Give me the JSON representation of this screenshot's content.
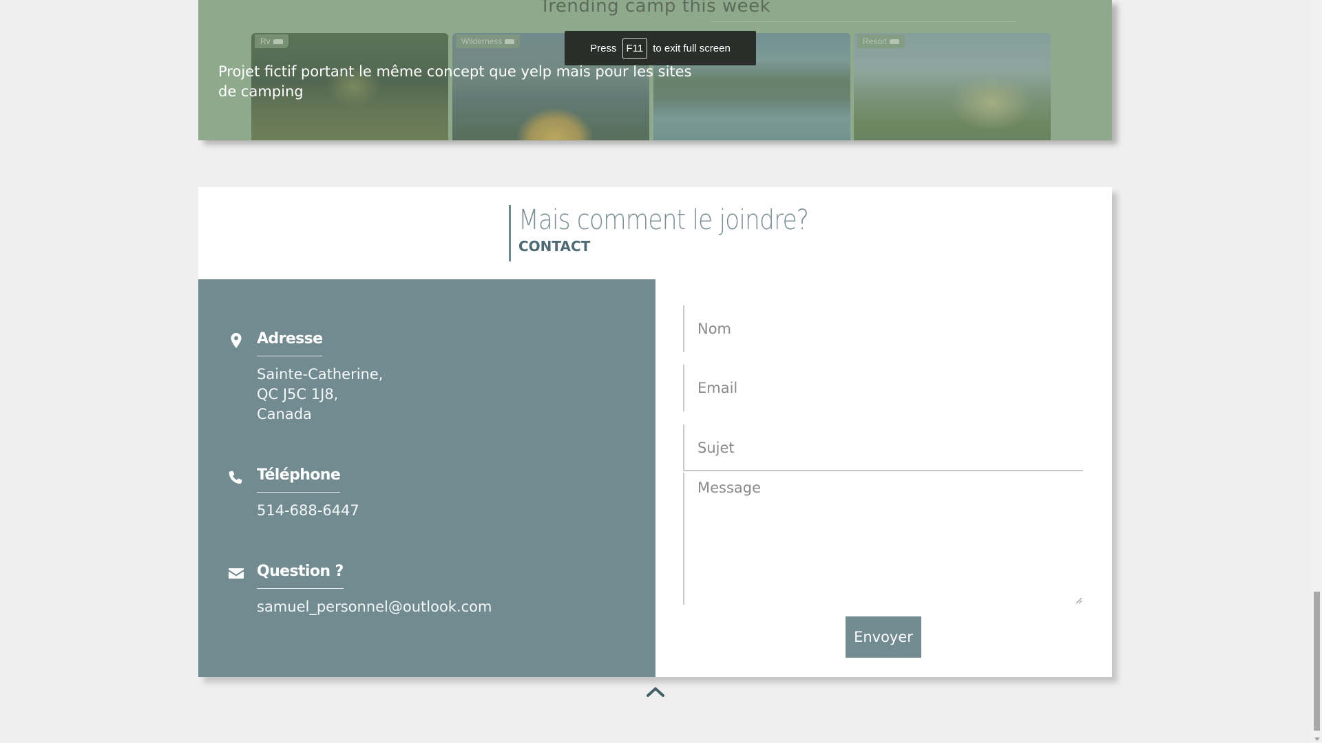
{
  "hero": {
    "title": "Trending camp this week",
    "description": "Projet fictif portant le même concept que yelp mais pour les sites de camping",
    "thumbnails": [
      {
        "tag": "Rv"
      },
      {
        "tag": "Wilderness"
      },
      {
        "tag": ""
      },
      {
        "tag": "Resort"
      }
    ]
  },
  "fullscreen_toast": {
    "prefix": "Press",
    "key": "F11",
    "suffix": "to exit full screen"
  },
  "contact": {
    "heading": "Mais comment le joindre?",
    "subheading": "CONTACT",
    "address": {
      "label": "Adresse",
      "lines": [
        "Sainte-Catherine,",
        "QC J5C 1J8,",
        "Canada"
      ]
    },
    "phone": {
      "label": "Téléphone",
      "value": "514-688-6447"
    },
    "question": {
      "label": "Question ?",
      "value": "samuel_personnel@outlook.com"
    },
    "form": {
      "name_placeholder": "Nom",
      "email_placeholder": "Email",
      "subject_placeholder": "Sujet",
      "message_placeholder": "Message",
      "submit_label": "Envoyer"
    }
  },
  "colors": {
    "hero_bg": "#8fa98c",
    "panel_bg": "#728b91",
    "page_bg": "#efefef"
  },
  "icons": {
    "address": "map-marker-icon",
    "phone": "phone-icon",
    "email": "envelope-icon",
    "scroll_top": "chevron-up-icon"
  }
}
